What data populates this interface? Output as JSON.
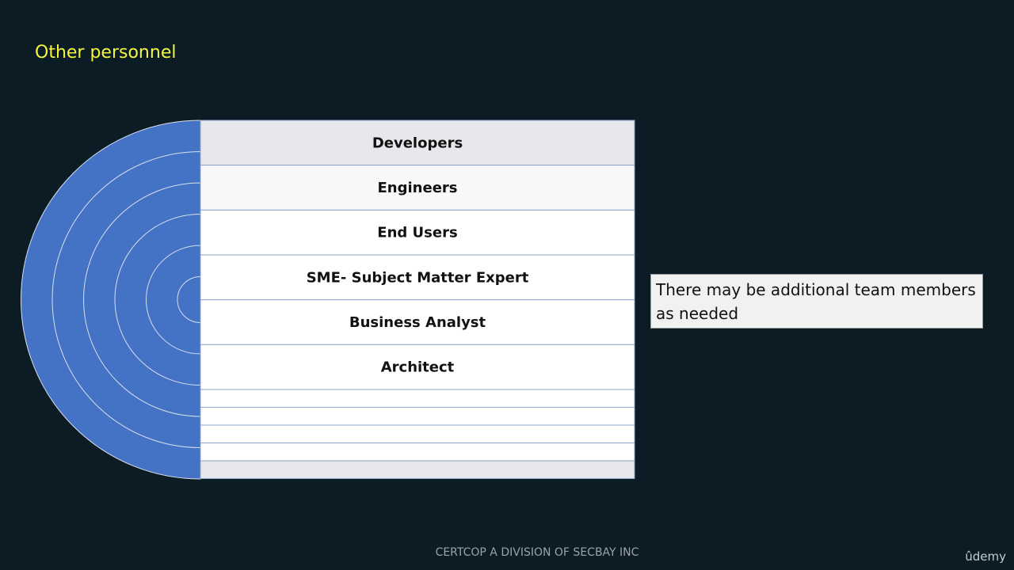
{
  "slide": {
    "title": "Other personnel"
  },
  "diagram": {
    "colors": {
      "arc_fill": "#4472c4",
      "arc_stroke": "#d8e0ee",
      "row_first_fill": "#e6e8eb",
      "row_fill": "#ffffff",
      "row_border": "#8fa6c8"
    },
    "rows": [
      {
        "label": "Developers"
      },
      {
        "label": "Engineers"
      },
      {
        "label": "End Users"
      },
      {
        "label": "SME- Subject Matter Expert"
      },
      {
        "label": "Business Analyst"
      },
      {
        "label": "Architect"
      }
    ],
    "empty_rows": 5
  },
  "callout": {
    "text": "There may be additional team members as needed"
  },
  "footer": {
    "text": "CERTCOP A DIVISION OF SECBAY INC"
  },
  "brand": {
    "text": "ûdemy"
  }
}
